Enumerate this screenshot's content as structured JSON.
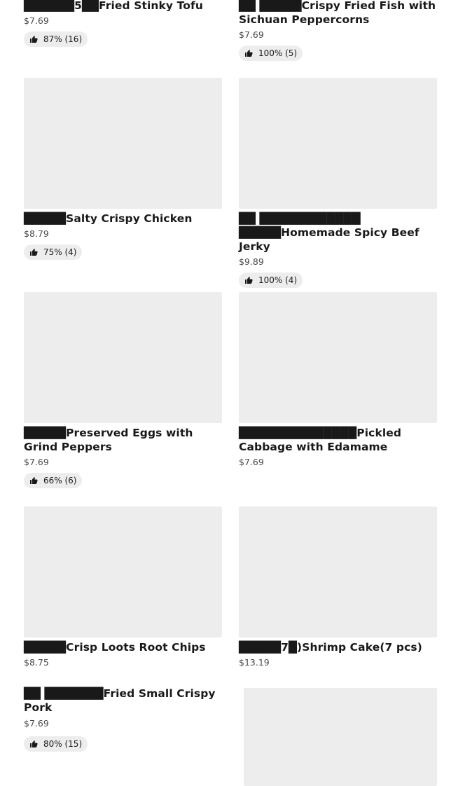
{
  "items": [
    {
      "title": "██████5██Fried Stinky Tofu",
      "price": "$7.69",
      "rating": "87% (16)"
    },
    {
      "title": "██ █████Crispy Fried Fish with Sichuan Peppercorns",
      "price": "$7.69",
      "rating": "100% (5)"
    },
    {
      "title": "█████Salty Crispy Chicken",
      "price": "$8.79",
      "rating": "75% (4)"
    },
    {
      "title": "██ ████████████ █████Homemade Spicy Beef Jerky",
      "price": "$9.89",
      "rating": "100% (4)"
    },
    {
      "title": "█████Preserved Eggs with Grind Peppers",
      "price": "$7.69",
      "rating": "66% (6)"
    },
    {
      "title": "██████████████Pickled Cabbage with Edamame",
      "price": "$7.69",
      "rating": ""
    },
    {
      "title": "█████Crisp Loots Root Chips",
      "price": "$8.75",
      "rating": ""
    },
    {
      "title": "█████7█)Shrimp Cake(7 pcs)",
      "price": "$13.19",
      "rating": ""
    },
    {
      "title": "██ ███████Fried Small Crispy Pork",
      "price": "$7.69",
      "rating": "80% (15)"
    }
  ],
  "icons": {
    "rating": "thumbs-up-icon"
  }
}
